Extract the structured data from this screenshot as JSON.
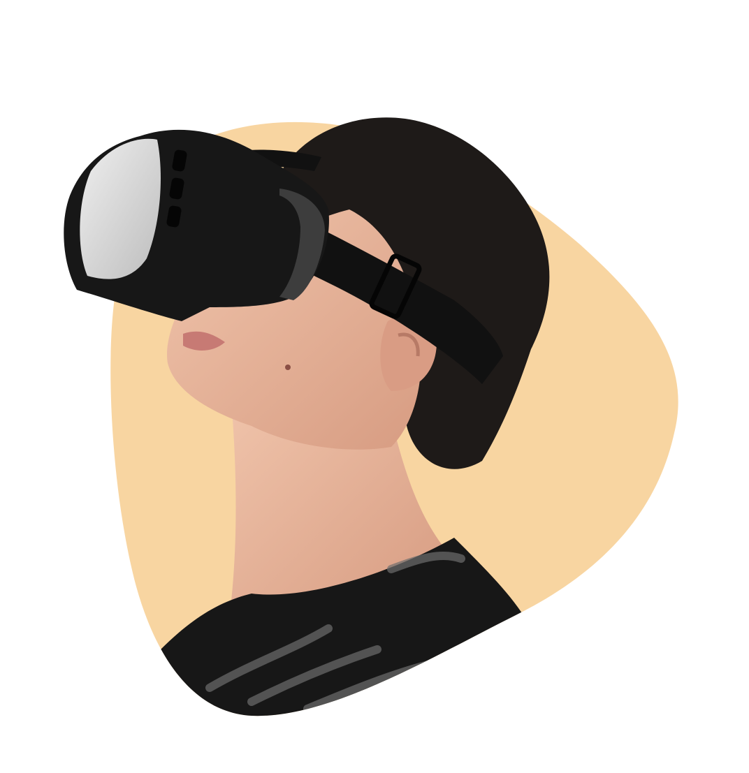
{
  "scene": {
    "subject": "person-wearing-vr-headset",
    "colors": {
      "background": "#ffffff",
      "blob": "#f8d5a1",
      "skin": "#e8b49a",
      "skin_shadow": "#c98f76",
      "hair": "#1e1a18",
      "headset_body": "#171717",
      "headset_face": "#d9d9d9",
      "strap": "#111111",
      "shirt": "#171717",
      "shirt_pattern": "#6e6e6e",
      "lips": "#c77a74"
    }
  }
}
